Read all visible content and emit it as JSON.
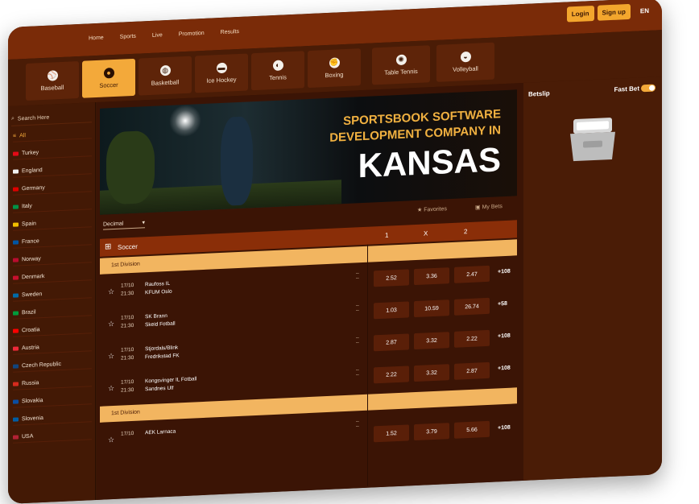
{
  "nav": [
    "Home",
    "Sports",
    "Live",
    "Promotion",
    "Results"
  ],
  "auth": {
    "login": "Login",
    "signup": "Sign up",
    "lang": "EN"
  },
  "sports": [
    {
      "label": "Baseball",
      "icon": "baseball-icon",
      "active": false
    },
    {
      "label": "Soccer",
      "icon": "soccer-ball-icon",
      "active": true
    },
    {
      "label": "Basketball",
      "icon": "basketball-icon",
      "active": false
    },
    {
      "label": "Ice Hockey",
      "icon": "hockey-puck-icon",
      "active": false
    },
    {
      "label": "Tennis",
      "icon": "tennis-ball-icon",
      "active": false
    },
    {
      "label": "Boxing",
      "icon": "boxing-glove-icon",
      "active": false
    },
    {
      "label": "Table Tennis",
      "icon": "table-tennis-icon",
      "active": false
    },
    {
      "label": "Volleyball",
      "icon": "volleyball-icon",
      "active": false
    }
  ],
  "sidebar": {
    "search_placeholder": "Search Here",
    "all_label": "All",
    "countries": [
      "Turkey",
      "England",
      "Germany",
      "Italy",
      "Spain",
      "France",
      "Norway",
      "Denmark",
      "Sweden",
      "Brazil",
      "Croatia",
      "Austria",
      "Czech Republic",
      "Russia",
      "Slovakia",
      "Slovenia",
      "USA"
    ]
  },
  "banner": {
    "line1": "SPORTSBOOK SOFTWARE",
    "line2": "DEVELOPMENT COMPANY IN",
    "line3": "KANSAS"
  },
  "tools": {
    "odds_format": "Decimal",
    "favorites": "Favorites",
    "my_bets": "My Bets"
  },
  "market": {
    "title": "Soccer",
    "col1": "1",
    "colx": "X",
    "col2": "2"
  },
  "divisions": [
    {
      "name": "1st Division",
      "matches": [
        {
          "date": "17/10",
          "time": "21:30",
          "home": "Raufoss IL",
          "away": "KFUM Oslo",
          "o1": "2.52",
          "ox": "3.36",
          "o2": "2.47",
          "more": "+108"
        },
        {
          "date": "17/10",
          "time": "21:30",
          "home": "SK Brann",
          "away": "Skeid Fotball",
          "o1": "1.03",
          "ox": "10.59",
          "o2": "26.74",
          "more": "+58"
        },
        {
          "date": "17/10",
          "time": "21:30",
          "home": "Stjordals/Blink",
          "away": "Fredrikstad FK",
          "o1": "2.87",
          "ox": "3.32",
          "o2": "2.22",
          "more": "+108"
        },
        {
          "date": "17/10",
          "time": "21:30",
          "home": "Kongsvinger IL Fotball",
          "away": "Sandnes Ulf",
          "o1": "2.22",
          "ox": "3.32",
          "o2": "2.87",
          "more": "+108"
        }
      ]
    },
    {
      "name": "1st Division",
      "matches": [
        {
          "date": "17/10",
          "time": "",
          "home": "AEK Larnaca",
          "away": "",
          "o1": "1.52",
          "ox": "3.79",
          "o2": "5.66",
          "more": "+108"
        }
      ]
    }
  ],
  "betslip": {
    "title": "Betslip",
    "fast_bet": "Fast Bet"
  },
  "colors": {
    "topbar": "#7a2b08",
    "accent": "#f3a93a",
    "panel": "#4a1c06",
    "bg": "#3a1705"
  }
}
